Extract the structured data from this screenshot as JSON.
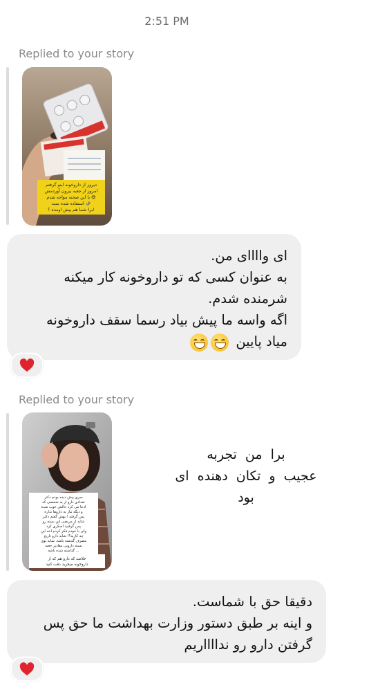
{
  "timestamp": "2:51 PM",
  "messages": [
    {
      "replied_label": "Replied to your story",
      "story_caption_lines": [
        "دیروز از داروخونه اینو گرفتم",
        "امروز از جعبه بیرون آوردمش",
        "با این صحنه مواجه شدم 😄",
        "استفاده شده ست 🤣",
        "برا شما هم پیش اومده ؟!"
      ],
      "reply_lines": [
        "ای واااای من.",
        "به عنوان کسی که تو داروخونه کار میکنه",
        "شرمنده شدم.",
        "اگه واسه ما پیش بیاد رسما سقف داروخونه",
        "میاد پایین"
      ],
      "reaction": "❤️"
    },
    {
      "replied_label": "Replied to your story",
      "story_caption_lines": [
        "سری پیش دیده بودم دکتر",
        "تعدادی دارو از یه شخصی که",
        "ادعا می کرد حالش خوب شده",
        "و دیگه نیاز به داروها نداره",
        "پس گرفته ! بهش گفتم دکتر",
        "شاید از مریضی این بسته رو",
        "پس گرفتید اسکری کرد",
        "ولی با خودم فکر کردم اخه این",
        "چه کاریه؟! شاید دارو تاریخ",
        "مصرف گذشته باشه. شاید توی",
        "بسته دارویی مقادیر جعبه",
        "گذاشته شده باشه ...",
        "خلاصه که دارو هم که از",
        "داروخونه میخرید دقت کنید"
      ],
      "message_lines": [
        "برا من تجربه",
        "عجیب و تکان دهنده ای",
        "بود"
      ],
      "reply_lines": [
        "دقیقا حق با شماست.",
        "و اینه بر طبق دستور وزارت بهداشت ما حق پس",
        "گرفتن دارو رو ندااااریم"
      ],
      "reaction": "❤️"
    }
  ],
  "icons": {
    "emoji": "grinning-face-icon",
    "reaction": "red-heart-icon"
  },
  "colors": {
    "bubble_bg": "#efefef",
    "heart": "#e0242f",
    "label_gray": "#8a8a8a"
  }
}
